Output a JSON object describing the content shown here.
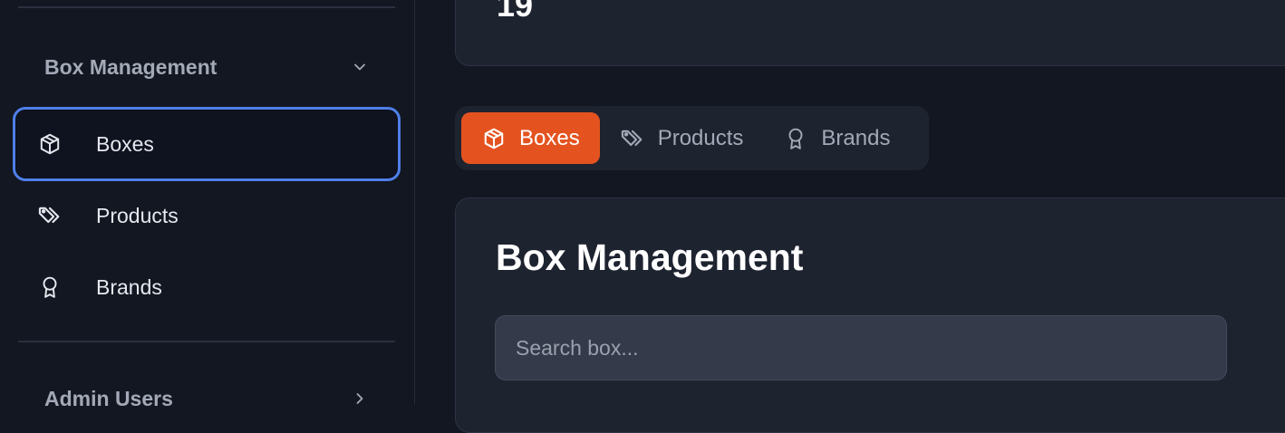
{
  "sidebar": {
    "group_title": "Box Management",
    "items": [
      {
        "label": "Boxes",
        "icon": "box-icon"
      },
      {
        "label": "Products",
        "icon": "tags-icon"
      },
      {
        "label": "Brands",
        "icon": "award-icon"
      }
    ],
    "group2_title": "Admin Users"
  },
  "stat_card": {
    "value": "19"
  },
  "tabs": [
    {
      "label": "Boxes",
      "icon": "box-icon",
      "active": true
    },
    {
      "label": "Products",
      "icon": "tags-icon"
    },
    {
      "label": "Brands",
      "icon": "award-icon"
    }
  ],
  "content": {
    "title": "Box Management",
    "search_placeholder": "Search box..."
  },
  "colors": {
    "accent": "#e4531f",
    "focus_ring": "#4f7fe8",
    "background": "#121722",
    "card": "#1e2330"
  }
}
